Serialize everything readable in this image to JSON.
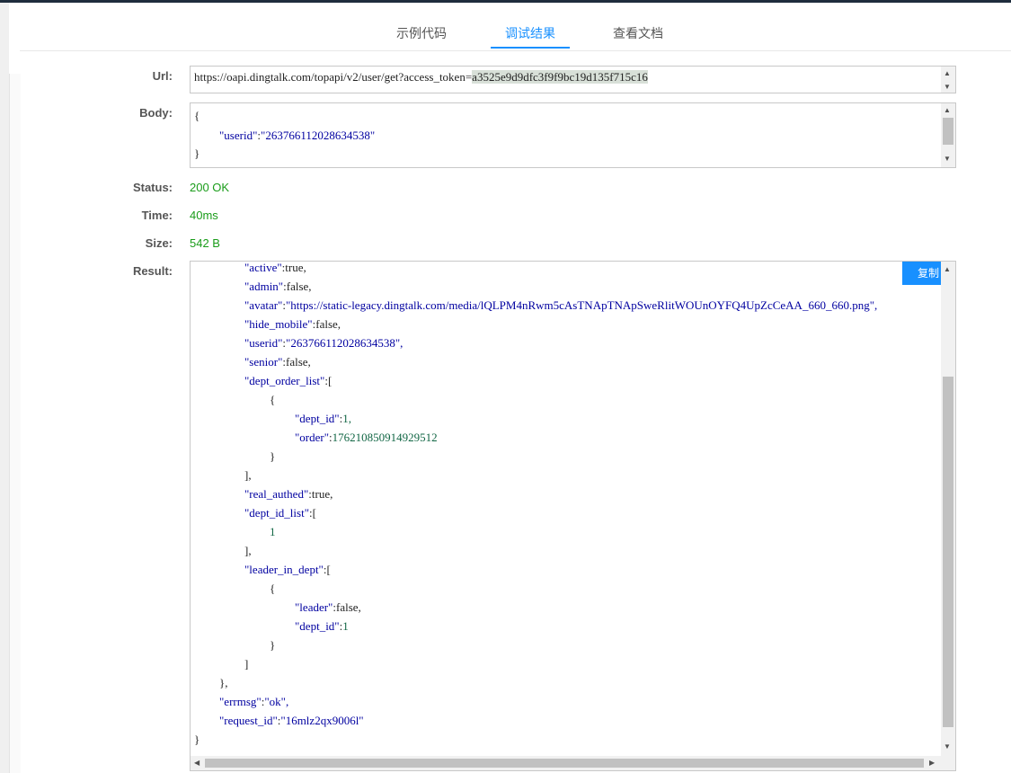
{
  "tabs": [
    {
      "label": "示例代码"
    },
    {
      "label": "调试结果"
    },
    {
      "label": "查看文档"
    }
  ],
  "labels": {
    "url": "Url:",
    "body": "Body:",
    "status": "Status:",
    "time": "Time:",
    "size": "Size:",
    "result": "Result:"
  },
  "url": {
    "prefix": "https://",
    "path": "oapi.dingtalk.com/topapi/v2/user/get?access_token=",
    "token": "a3525e9d9dfc3f9f9bc19d135f715c16"
  },
  "body": {
    "open": "{",
    "key": "\"userid\"",
    "value": "\"263766112028634538\"",
    "close": "}"
  },
  "status": "200 OK",
  "time": "40ms",
  "size": "542 B",
  "copy_label": "复制",
  "result_lines": [
    {
      "k": "\"active\"",
      "v": "true,",
      "t": "p"
    },
    {
      "k": "\"admin\"",
      "v": "false,",
      "t": "p"
    },
    {
      "k": "\"avatar\"",
      "v": "\"https://static-legacy.dingtalk.com/media/lQLPM4nRwm5cAsTNApTNApSweRlitWOUnOYFQ4UpZcCeAA_660_660.png\",",
      "t": "s"
    },
    {
      "k": "\"hide_mobile\"",
      "v": "false,",
      "t": "p"
    },
    {
      "k": "\"userid\"",
      "v": "\"263766112028634538\",",
      "t": "s"
    },
    {
      "k": "\"senior\"",
      "v": "false,",
      "t": "p"
    },
    {
      "k": "\"dept_order_list\"",
      "v": "[",
      "t": "p"
    },
    {
      "k": "",
      "v": "{",
      "t": "p"
    },
    {
      "k": "\"dept_id\"",
      "v": "1,",
      "t": "n"
    },
    {
      "k": "\"order\"",
      "v": "176210850914929512",
      "t": "n"
    },
    {
      "k": "",
      "v": "}",
      "t": "p"
    },
    {
      "k": "",
      "v": "],",
      "t": "p"
    },
    {
      "k": "\"real_authed\"",
      "v": "true,",
      "t": "p"
    },
    {
      "k": "\"dept_id_list\"",
      "v": "[",
      "t": "p"
    },
    {
      "k": "",
      "v": "1",
      "t": "n"
    },
    {
      "k": "",
      "v": "],",
      "t": "p"
    },
    {
      "k": "\"leader_in_dept\"",
      "v": "[",
      "t": "p"
    },
    {
      "k": "",
      "v": "{",
      "t": "p"
    },
    {
      "k": "\"leader\"",
      "v": "false,",
      "t": "p"
    },
    {
      "k": "\"dept_id\"",
      "v": "1",
      "t": "n"
    },
    {
      "k": "",
      "v": "}",
      "t": "p"
    },
    {
      "k": "",
      "v": "]",
      "t": "p"
    },
    {
      "k": "",
      "v": "},",
      "t": "p"
    },
    {
      "k": "\"errmsg\"",
      "v": "\"ok\",",
      "t": "s"
    },
    {
      "k": "\"request_id\"",
      "v": "\"16mlz2qx9006l\"",
      "t": "s"
    },
    {
      "k": "",
      "v": "}",
      "t": "p"
    }
  ],
  "icons": {
    "scroll_up": "triangle-up",
    "scroll_down": "triangle-down",
    "scroll_left": "triangle-left",
    "scroll_right": "triangle-right"
  }
}
